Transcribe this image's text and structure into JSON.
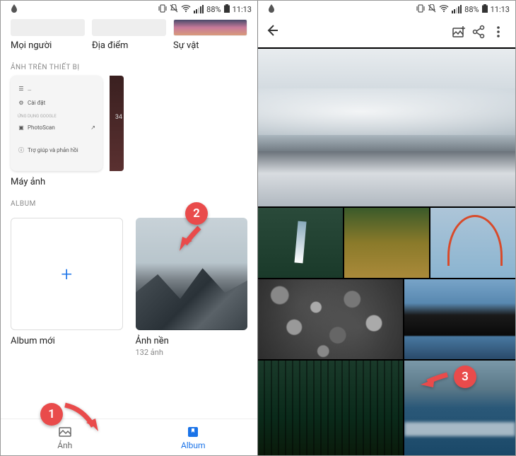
{
  "status": {
    "battery_pct": "88%",
    "time": "11:13"
  },
  "left": {
    "categories": [
      {
        "label": "Mọi người"
      },
      {
        "label": "Địa điểm"
      },
      {
        "label": "Sự vật"
      }
    ],
    "section_device": "ẢNH TRÊN THIẾT BỊ",
    "menu_card": {
      "cai_dat": "Cài đặt",
      "section": "ỨNG DỤNG GOOGLE",
      "photoscan": "PhotoScan",
      "help": "Trợ giúp và phản hồi",
      "badge": "34"
    },
    "device_label": "Máy ảnh",
    "section_album": "ALBUM",
    "albums": {
      "new": {
        "title": "Album mới"
      },
      "existing": {
        "title": "Ảnh nền",
        "count": "132 ảnh"
      }
    },
    "nav": {
      "photos": "Ảnh",
      "album": "Album"
    }
  },
  "annotations": {
    "b1": "1",
    "b2": "2",
    "b3": "3"
  }
}
